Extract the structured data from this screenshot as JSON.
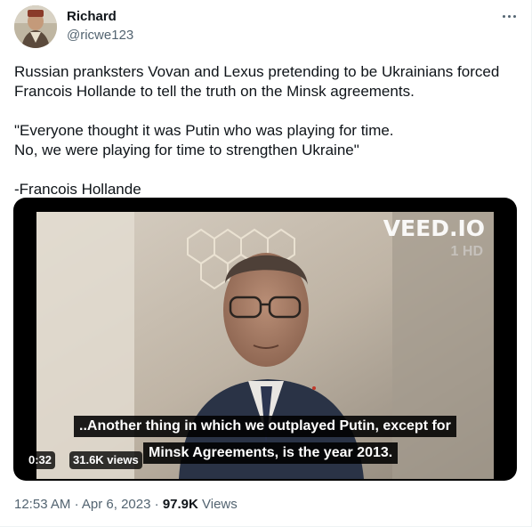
{
  "author": {
    "name": "Richard",
    "handle": "@ricwe123"
  },
  "tweet": {
    "paragraphs": [
      "Russian pranksters Vovan and Lexus pretending to be Ukrainians forced",
      "Francois Hollande to tell the truth on the Minsk agreements.",
      "\"Everyone thought it was Putin who was playing for time.",
      "No, we were playing for time to strengthen Ukraine\"",
      "-Francois Hollande"
    ]
  },
  "video": {
    "watermark": "VEED.IO",
    "channel_logo": "1 HD",
    "subtitle_line1": "..Another thing in which we outplayed Putin, except for",
    "subtitle_line2": "Minsk Agreements, is the year 2013.",
    "duration": "0:32",
    "views": "31.6K views"
  },
  "meta": {
    "time": "12:53 AM",
    "separator": "·",
    "date": "Apr 6, 2023",
    "view_count": "97.9K",
    "views_label": "Views"
  },
  "icons": {
    "more": "more-horizontal-icon"
  },
  "colors": {
    "text_primary": "#0f1419",
    "text_secondary": "#536471",
    "border": "#eff3f4"
  }
}
